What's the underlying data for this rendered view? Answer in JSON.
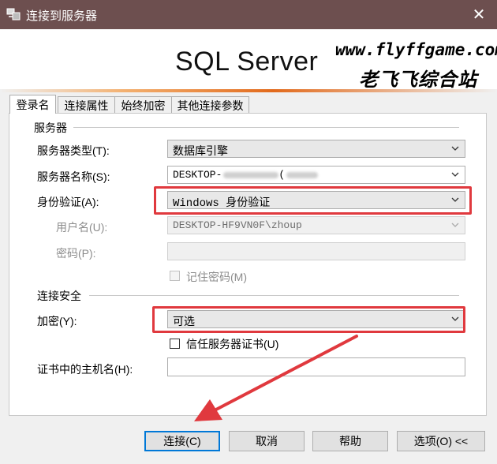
{
  "window": {
    "title": "连接到服务器",
    "close_glyph": "✕"
  },
  "banner": {
    "brand": "SQL Server",
    "watermark_url": "www.flyffgame.com",
    "watermark_name": "老飞飞综合站"
  },
  "tabs": [
    "登录名",
    "连接属性",
    "始终加密",
    "其他连接参数"
  ],
  "server_group": {
    "title": "服务器",
    "server_type": {
      "label": "服务器类型(T):",
      "value": "数据库引擎"
    },
    "server_name": {
      "label": "服务器名称(S):",
      "value": "DESKTOP-",
      "value_tail": "("
    },
    "auth": {
      "label": "身份验证(A):",
      "value": "Windows 身份验证"
    },
    "username": {
      "label": "用户名(U):",
      "value": "DESKTOP-HF9VN0F\\zhoup"
    },
    "password": {
      "label": "密码(P):",
      "value": ""
    },
    "remember": {
      "label": "记住密码(M)",
      "checked": false
    }
  },
  "security_group": {
    "title": "连接安全",
    "encrypt": {
      "label": "加密(Y):",
      "value": "可选"
    },
    "trust_cert": {
      "label": "信任服务器证书(U)",
      "checked": false
    },
    "host_in_cert": {
      "label": "证书中的主机名(H):",
      "value": ""
    }
  },
  "buttons": {
    "connect": "连接(C)",
    "cancel": "取消",
    "help": "帮助",
    "options": "选项(O) <<"
  },
  "colors": {
    "title_bar": "#6d4f4f",
    "highlight": "#e0393e",
    "accent_blue": "#0078d7"
  }
}
